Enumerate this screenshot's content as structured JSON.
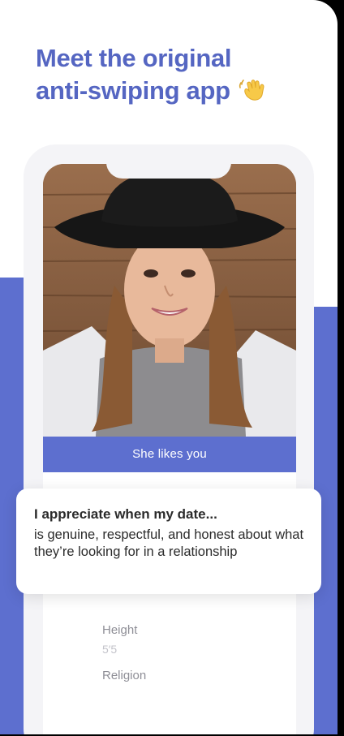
{
  "headline": {
    "line1": "Meet the original",
    "line2": "anti-swiping app",
    "emoji": "waving-hand-icon"
  },
  "profile": {
    "photo": "profile-photo",
    "likes_label": "She likes you"
  },
  "prompt": {
    "title": "I appreciate when my date...",
    "answer": "is genuine, respectful, and honest about what they’re looking for in a relationship"
  },
  "details": {
    "height_label": "Height",
    "height_value": "5′5",
    "religion_label": "Religion"
  },
  "colors": {
    "accent": "#5d6fcf",
    "headline": "#5566c2",
    "text": "#2b2b2b",
    "muted": "#8e8e96"
  }
}
